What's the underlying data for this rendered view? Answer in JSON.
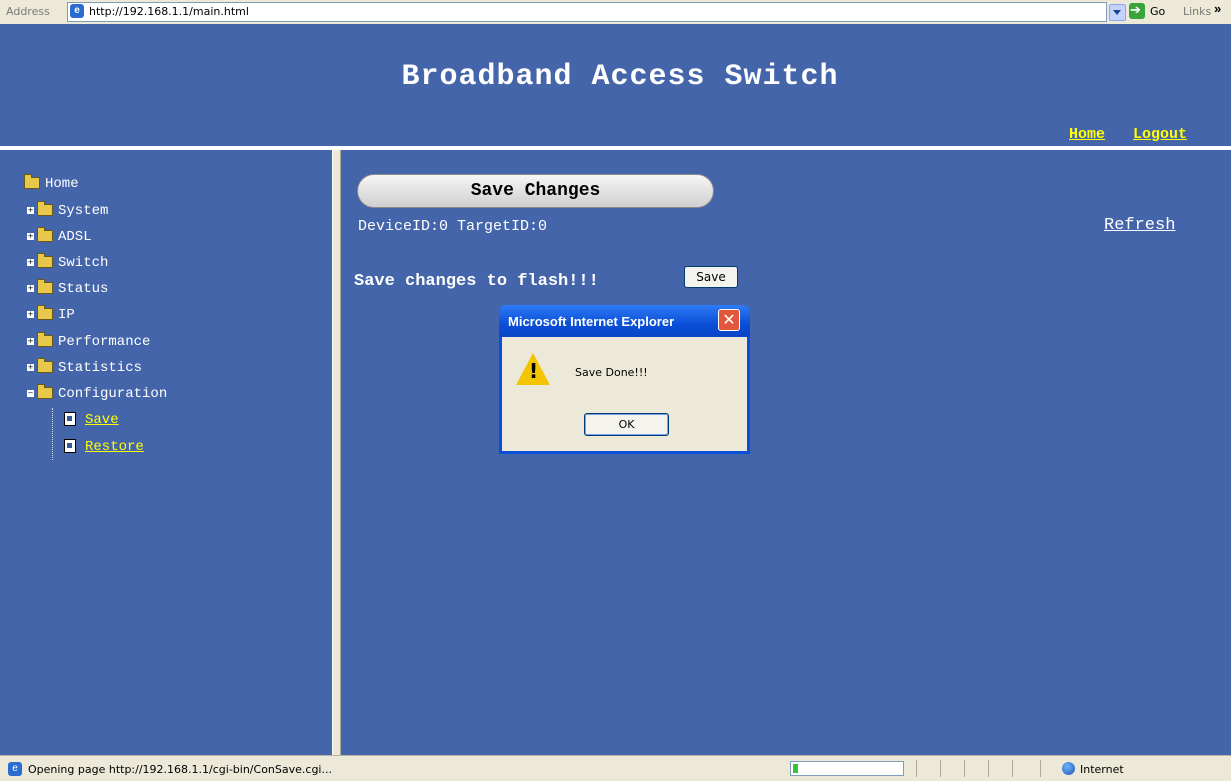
{
  "browser": {
    "address_label": "Address",
    "url": "http://192.168.1.1/main.html",
    "go_label": "Go",
    "links_label": "Links",
    "links_chevron": "»"
  },
  "header": {
    "title": "Broadband Access Switch",
    "home_link": "Home",
    "logout_link": "Logout"
  },
  "tree": {
    "root": "Home",
    "items": [
      {
        "label": "System",
        "expander": "+"
      },
      {
        "label": "ADSL",
        "expander": "+"
      },
      {
        "label": "Switch",
        "expander": "+"
      },
      {
        "label": "Status",
        "expander": "+"
      },
      {
        "label": "IP",
        "expander": "+"
      },
      {
        "label": "Performance",
        "expander": "+"
      },
      {
        "label": "Statistics",
        "expander": "+"
      },
      {
        "label": "Configuration",
        "expander": "−"
      }
    ],
    "children": [
      {
        "label": "Save"
      },
      {
        "label": "Restore"
      }
    ]
  },
  "main": {
    "save_changes_label": "Save Changes",
    "device_line": "DeviceID:0 TargetID:0",
    "refresh_link": "Refresh",
    "flash_label": "Save changes to flash!!!",
    "save_button": "Save"
  },
  "dialog": {
    "title": "Microsoft Internet Explorer",
    "close_glyph": "✕",
    "icon": "warning-icon",
    "message": "Save Done!!!",
    "ok_button": "OK"
  },
  "statusbar": {
    "text": "Opening page http://192.168.1.1/cgi-bin/ConSave.cgi...",
    "zone": "Internet",
    "progress": 0.05
  },
  "colors": {
    "page_bg": "#4565ab",
    "link_yellow": "#ffff00",
    "dialog_titlebar": "#0a4fd8"
  }
}
